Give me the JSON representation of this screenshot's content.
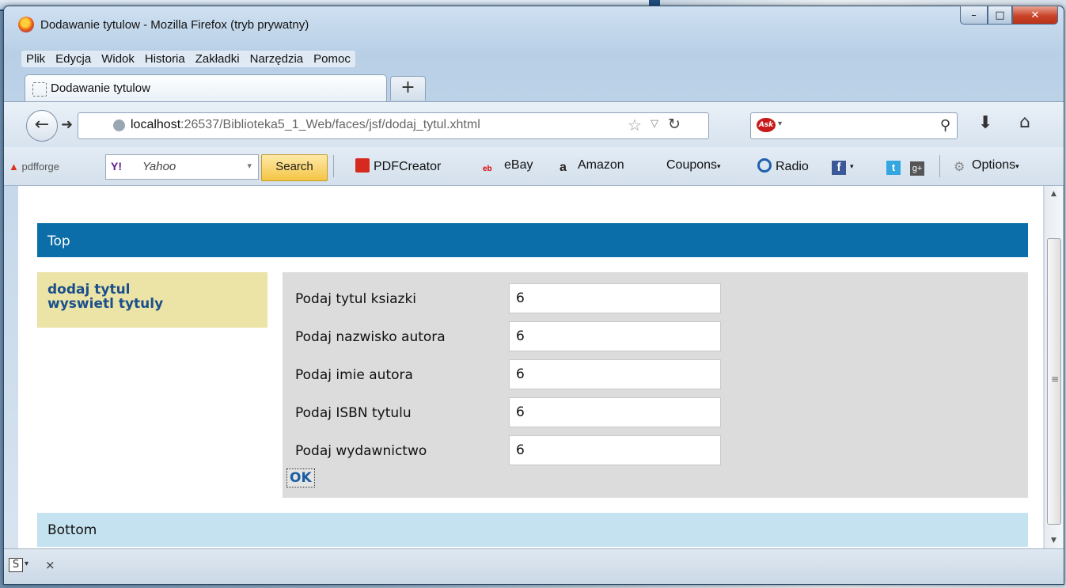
{
  "window": {
    "title": "Dodawanie tytulow - Mozilla Firefox (tryb prywatny)"
  },
  "menubar": [
    {
      "label": "Plik"
    },
    {
      "label": "Edycja"
    },
    {
      "label": "Widok"
    },
    {
      "label": "Historia"
    },
    {
      "label": "Zakładki"
    },
    {
      "label": "Narzędzia"
    },
    {
      "label": "Pomoc"
    }
  ],
  "tab": {
    "title": "Dodawanie tytulow",
    "new_tab": "+"
  },
  "address": {
    "host": "localhost",
    "path": ":26537/Biblioteka5_1_Web/faces/jsf/dodaj_tytul.xhtml"
  },
  "toolbar": {
    "pdfforge": "pdfforge",
    "yahoo_engine": "Yahoo",
    "search_button": "Search",
    "pdfcreator": "PDFCreator",
    "ebay": "eBay",
    "amazon": "Amazon",
    "coupons": "Coupons",
    "radio": "Radio",
    "options": "Options"
  },
  "page": {
    "top": "Top",
    "bottom": "Bottom",
    "nav": [
      "dodaj tytul",
      "wyswietl tytuly"
    ],
    "form": [
      {
        "label": "Podaj tytul ksiazki",
        "value": "6"
      },
      {
        "label": "Podaj nazwisko autora",
        "value": "6"
      },
      {
        "label": "Podaj imie autora",
        "value": "6"
      },
      {
        "label": "Podaj ISBN tytulu",
        "value": "6"
      },
      {
        "label": "Podaj wydawnictwo",
        "value": "6"
      }
    ],
    "submit": "OK"
  },
  "colors": {
    "top_region": "#0c6ea8",
    "left_nav": "#ece3a6",
    "form_panel": "#dcdcdc",
    "bottom_region": "#c5e2f1",
    "nav_link": "#1a4f8b"
  }
}
